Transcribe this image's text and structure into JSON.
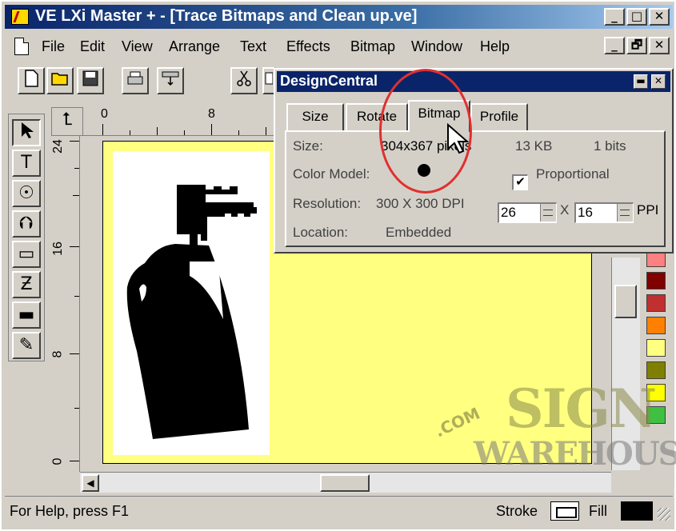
{
  "window": {
    "title": "VE LXi Master + - [Trace Bitmaps and Clean up.ve]",
    "min": "_",
    "max": "□",
    "close": "✕",
    "restore": "🗗"
  },
  "menu": [
    "File",
    "Edit",
    "View",
    "Arrange",
    "Text",
    "Effects",
    "Bitmap",
    "Window",
    "Help"
  ],
  "toolbar_icons": [
    "new-icon",
    "open-icon",
    "save-icon",
    "print-icon",
    "plot-icon",
    "cut-icon",
    "copy-icon"
  ],
  "tools": [
    "pointer-tool-icon",
    "text-tool-icon",
    "node-tool-icon",
    "pen-tool-icon",
    "rectangle-tool-icon",
    "zoom-tool-icon",
    "measure-tool-icon",
    "eyedropper-tool-icon"
  ],
  "rulers": {
    "h_labels": [
      "0",
      "8"
    ],
    "v_labels": [
      "24",
      "16",
      "8",
      "0"
    ]
  },
  "panel": {
    "title": "DesignCentral",
    "tabs": [
      "Size",
      "Rotate",
      "Bitmap",
      "Profile"
    ],
    "active_tab": "Bitmap",
    "size_label": "Size:",
    "size_value": "304x367 pixels",
    "file_size": "13 KB",
    "bits": "1 bits",
    "color_model_label": "Color Model:",
    "proportional_label": "Proportional",
    "proportional_checked": true,
    "resolution_label": "Resolution:",
    "resolution_value": "300 X 300 DPI",
    "ppi_x": "26",
    "ppi_sep": "X",
    "ppi_y": "16",
    "ppi_unit": "PPI",
    "location_label": "Location:",
    "location_value": "Embedded"
  },
  "palette": [
    "#ff8080",
    "#800000",
    "#c03030",
    "#ff8000",
    "#ffff80",
    "#808000",
    "#ffff00",
    "#40c040"
  ],
  "status": {
    "help": "For Help, press F1",
    "stroke_label": "Stroke",
    "fill_label": "Fill"
  },
  "watermark": {
    "line1": "SIGN",
    "line2": "WAREHOUSE",
    "tag": ".COM"
  },
  "colors": {
    "title_bar": "#0a246a",
    "page": "#ffff80",
    "highlight_circle": "#e03030"
  }
}
